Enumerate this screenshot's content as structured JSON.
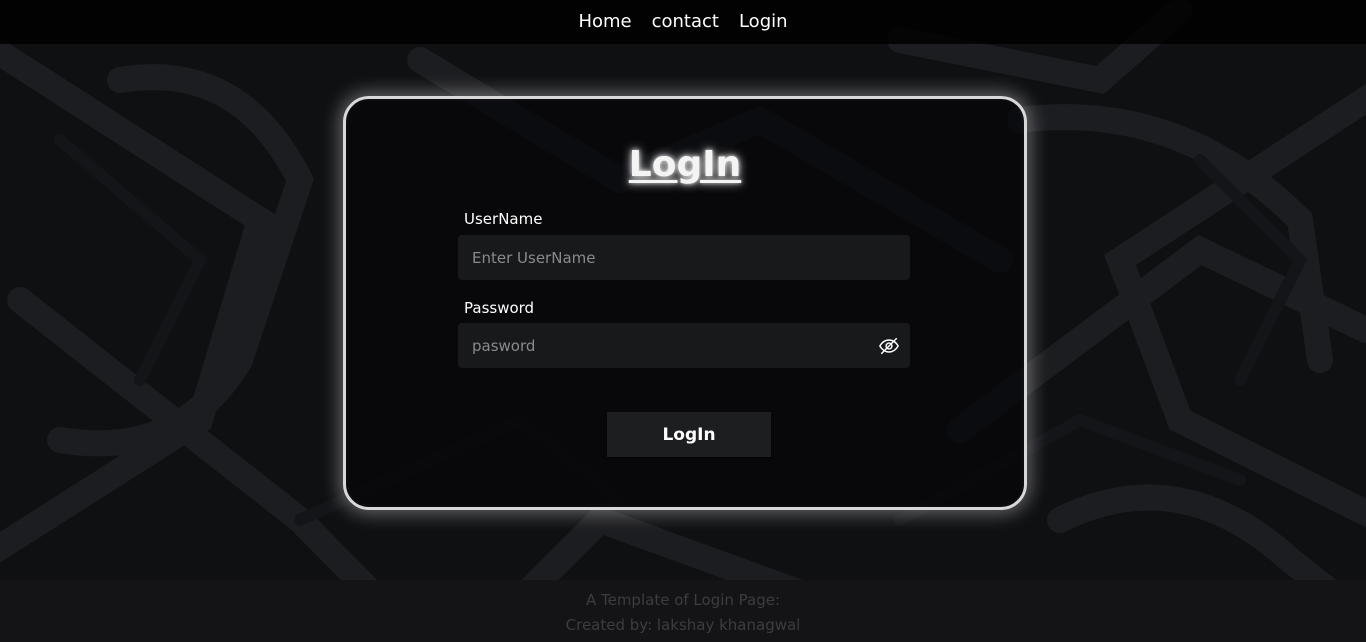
{
  "nav": {
    "items": [
      {
        "label": "Home"
      },
      {
        "label": "contact"
      },
      {
        "label": "Login"
      }
    ]
  },
  "login_card": {
    "title": "LogIn",
    "username_label": "UserName",
    "username_placeholder": "Enter UserName",
    "username_value": "",
    "password_label": "Password",
    "password_placeholder": "pasword",
    "password_value": "",
    "password_toggle_icon": "eye-slash-icon",
    "submit_label": "LogIn"
  },
  "footer": {
    "line1": "A Template of Login Page:",
    "line2": "Created by: lakshay khanagwal"
  },
  "colors": {
    "background": "#0f1012",
    "card_border": "#d8d8d8",
    "input_bg": "#18191b",
    "button_bg": "#1d1e20",
    "footer_text": "#3d3d40"
  }
}
